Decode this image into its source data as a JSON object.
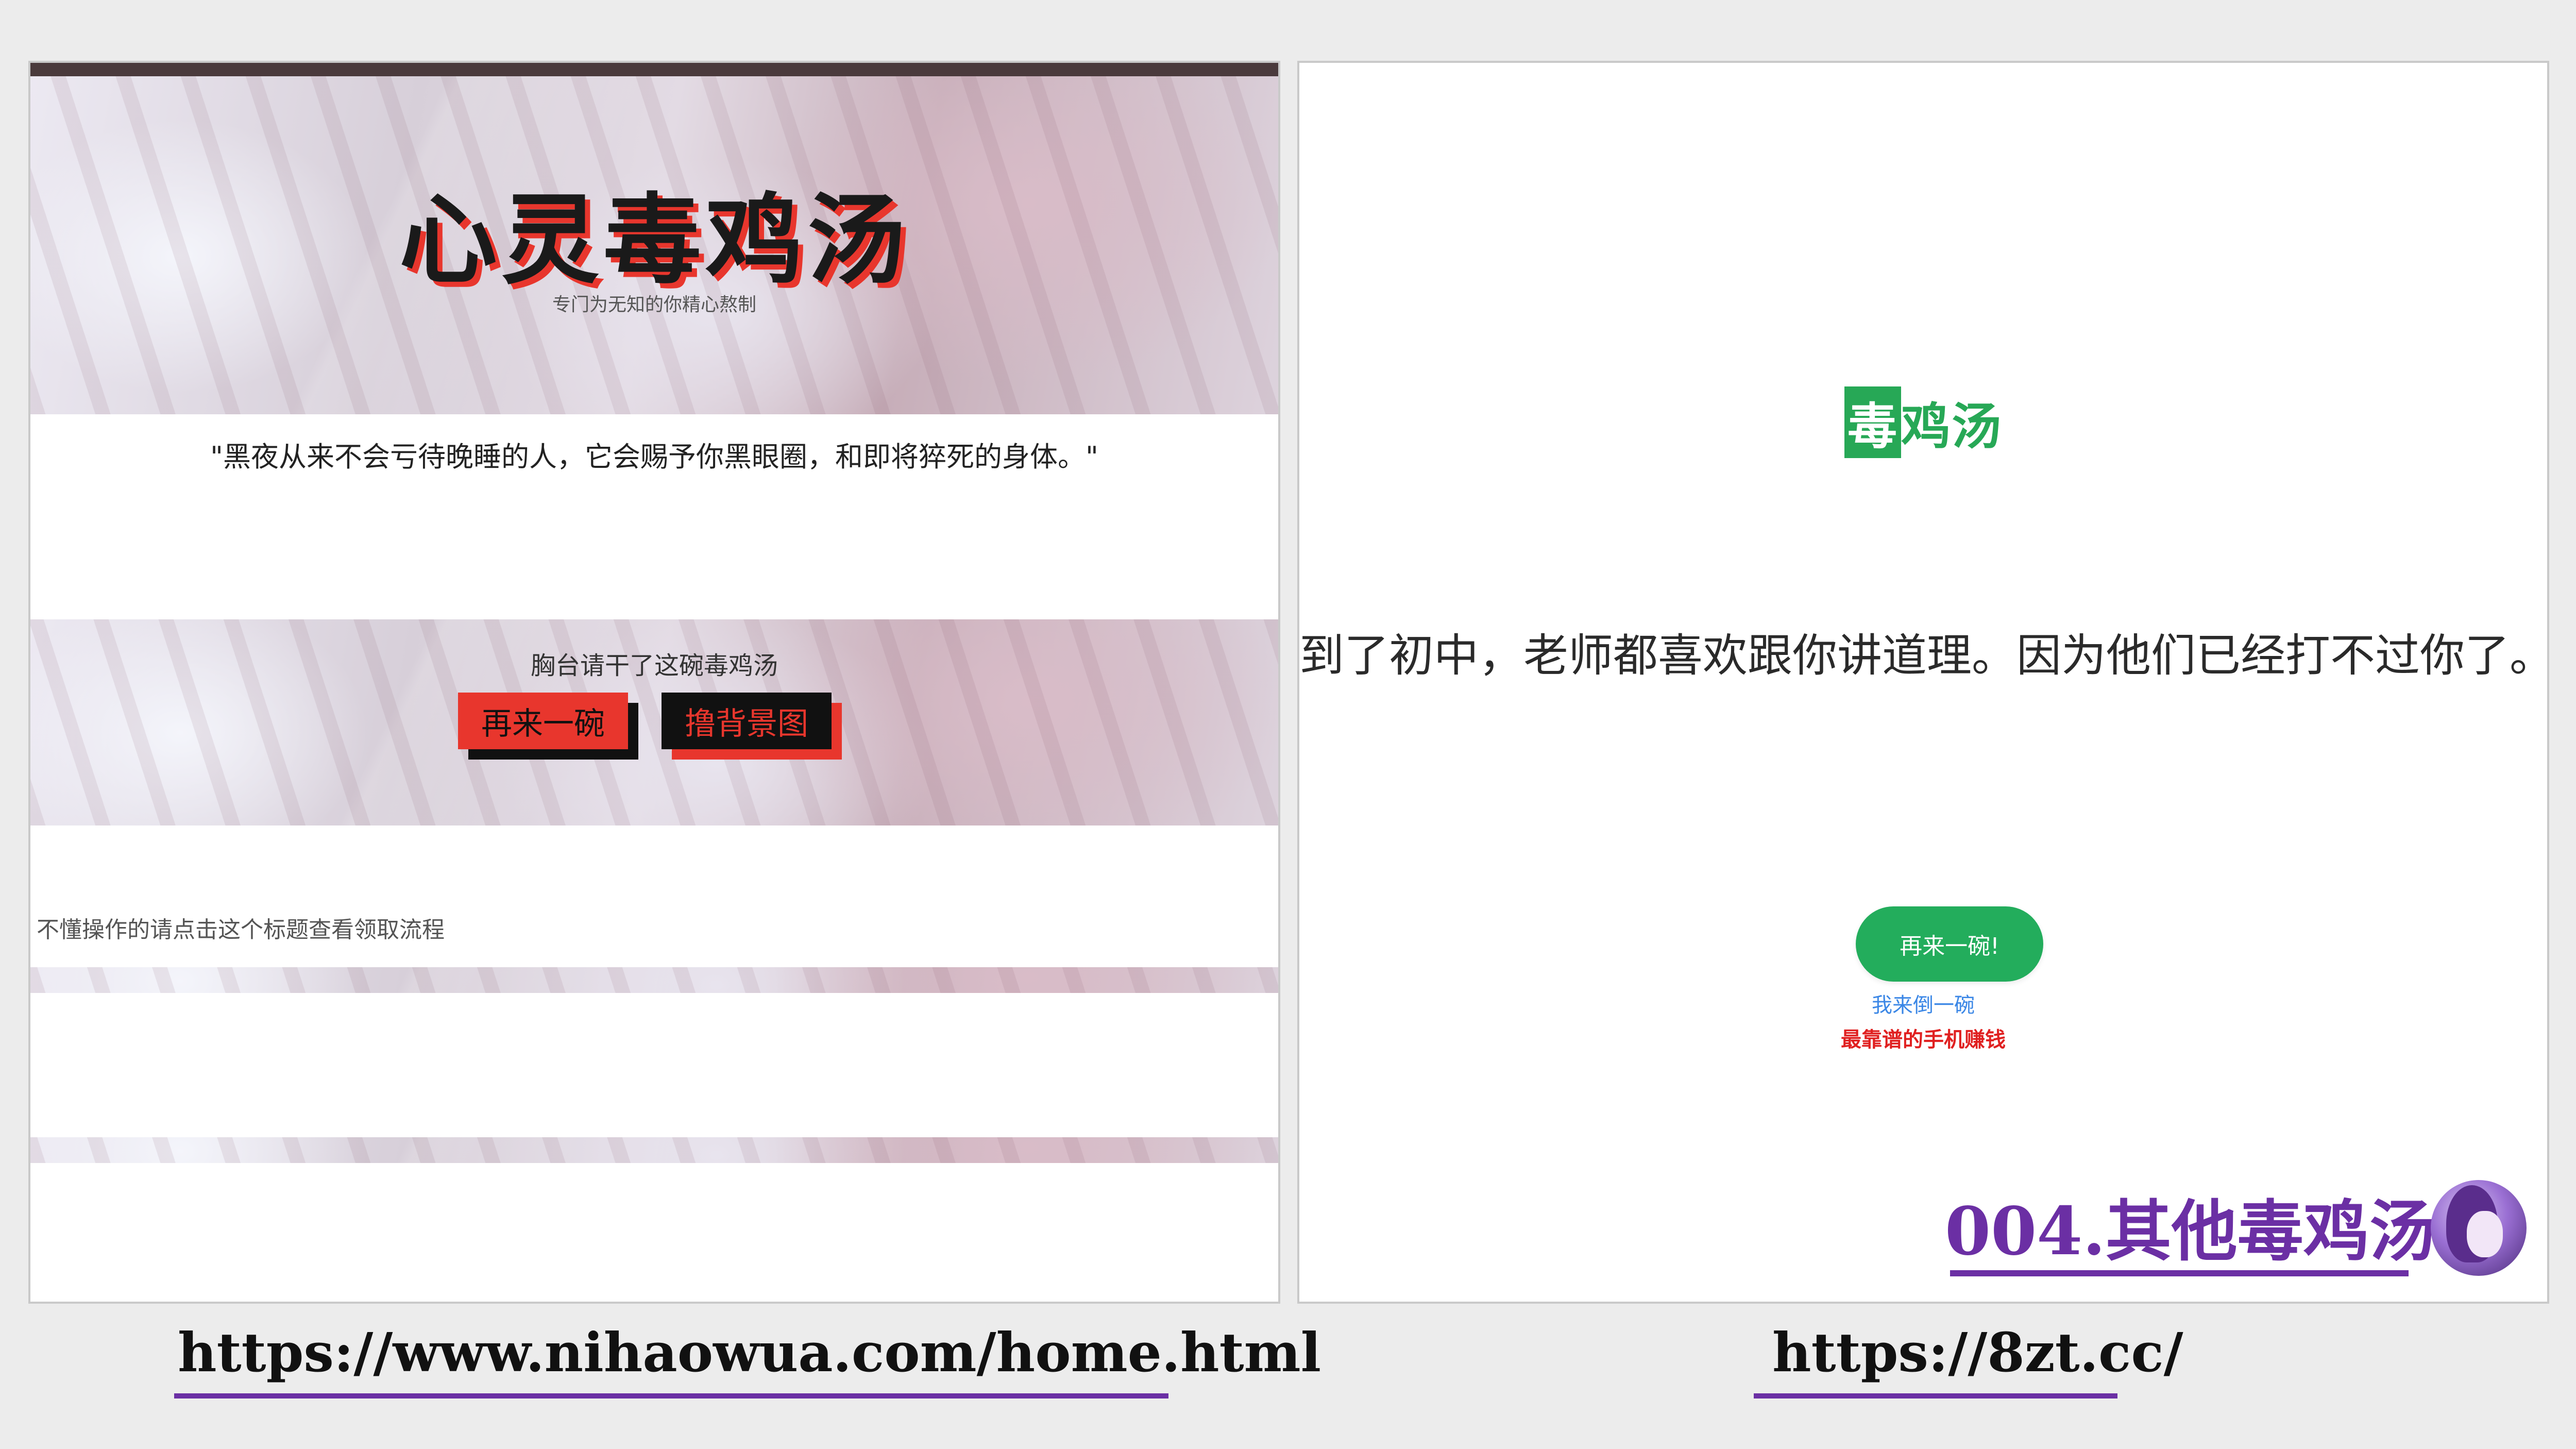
{
  "left_site": {
    "title": "心灵毒鸡汤",
    "subtitle": "专门为无知的你精心熬制",
    "quote": "\"黑夜从来不会亏待晚睡的人，它会赐予你黑眼圈，和即将猝死的身体。\"",
    "drink_prompt": "胸台请干了这碗毒鸡汤",
    "again_button": "再来一碗",
    "background_button": "撸背景图",
    "help_link": "不懂操作的请点击这个标题查看领取流程",
    "url": "https://www.nihaowua.com/home.html"
  },
  "right_site": {
    "logo_first_char": "毒",
    "logo_rest": "鸡汤",
    "quote": "到了初中，老师都喜欢跟你讲道理。因为他们已经打不过你了。",
    "again_button": "再来一碗!",
    "pour_link": "我来倒一碗",
    "earn_link": "最靠谱的手机赚钱",
    "url": "https://8zt.cc/"
  },
  "series_title": "004.其他毒鸡汤",
  "colors": {
    "accent_red": "#e8362d",
    "accent_green": "#23ad5c",
    "accent_purple": "#6b2fa4",
    "link_blue": "#3b87e6"
  }
}
